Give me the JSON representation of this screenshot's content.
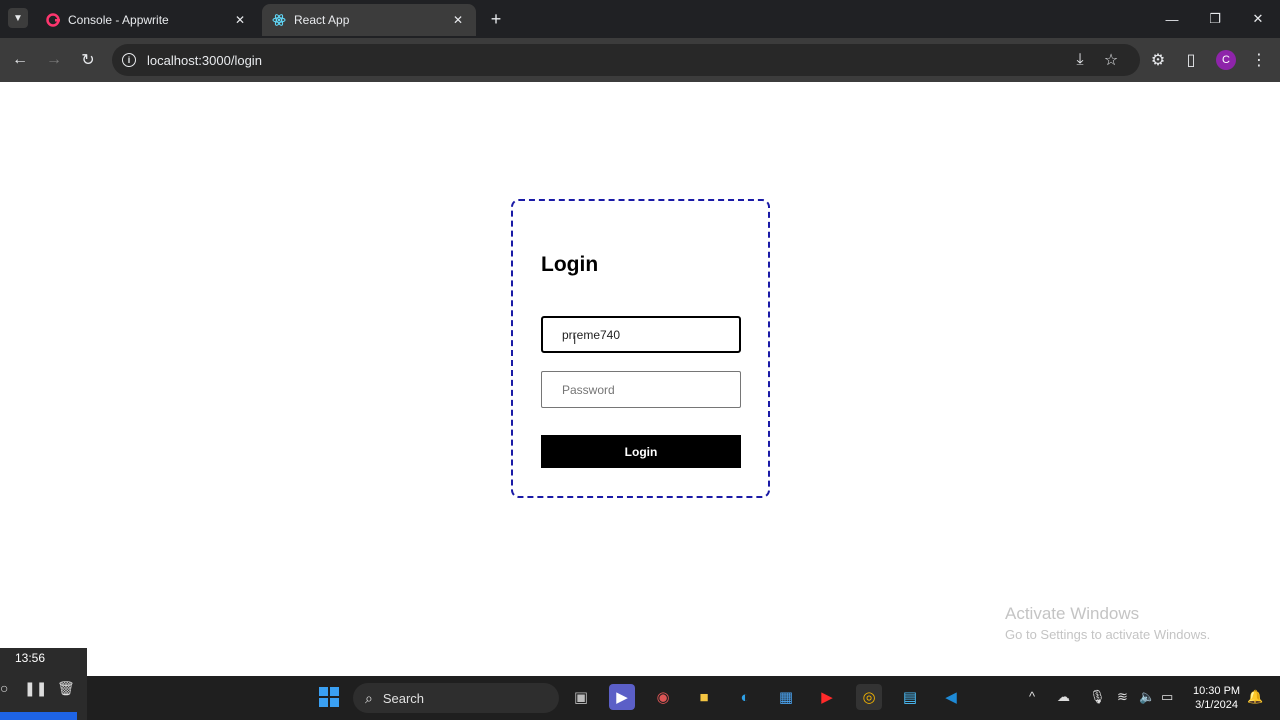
{
  "browser": {
    "tabs": [
      {
        "title": "Console - Appwrite",
        "favicon": "appwrite-icon",
        "active": false
      },
      {
        "title": "React App",
        "favicon": "react-icon",
        "active": true
      }
    ],
    "url": "localhost:3000/login",
    "profile_initial": "C"
  },
  "login": {
    "title": "Login",
    "username_value": "prreme740",
    "password_placeholder": "Password",
    "button_label": "Login"
  },
  "watermark": {
    "title": "Activate Windows",
    "subtitle": "Go to Settings to activate Windows."
  },
  "recorder": {
    "time": "13:56"
  },
  "taskbar": {
    "search_label": "Search",
    "time": "10:30 PM",
    "date": "3/1/2024"
  },
  "colors": {
    "card_border": "#1a1aa6",
    "button_bg": "#000000",
    "tab_strip": "#202124",
    "toolbar": "#3c3c3c"
  }
}
